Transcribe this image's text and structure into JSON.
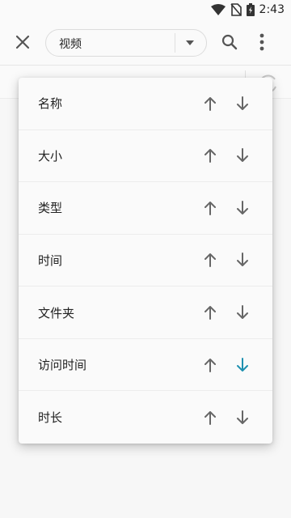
{
  "status_bar": {
    "time": "2:43"
  },
  "toolbar": {
    "type_filter": "视频"
  },
  "sort_menu": {
    "items": [
      {
        "label": "名称",
        "active": "none"
      },
      {
        "label": "大小",
        "active": "none"
      },
      {
        "label": "类型",
        "active": "none"
      },
      {
        "label": "时间",
        "active": "none"
      },
      {
        "label": "文件夹",
        "active": "none"
      },
      {
        "label": "访问时间",
        "active": "down"
      },
      {
        "label": "时长",
        "active": "none"
      }
    ]
  },
  "colors": {
    "accent": "#1e90b0",
    "icon": "#555555",
    "arrow": "#666666"
  },
  "icons": {
    "close": "close-icon",
    "dropdown": "triangle-down-icon",
    "search": "search-icon",
    "more": "more-vert-icon",
    "refresh": "refresh-icon",
    "sort_up": "arrow-up-icon",
    "sort_down": "arrow-down-icon"
  }
}
